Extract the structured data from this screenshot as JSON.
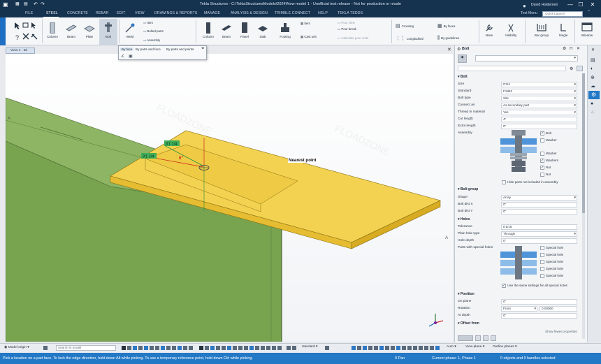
{
  "titlebar": {
    "title": "Tekla Structures - C:\\TeklaStructuresModels\\2024\\New model 1 - Unofficial test release - Not for production or resale",
    "user": "David Holdemen",
    "minimize": "—",
    "maximize": "☐",
    "close": "✕"
  },
  "menu": {
    "items": [
      "FILE",
      "STEEL",
      "CONCRETE",
      "REBAR",
      "EDIT",
      "VIEW",
      "DRAWINGS & REPORTS",
      "MANAGE",
      "ANALYSIS & DESIGN",
      "TRIMBLE CONNECT",
      "HELP",
      "TEKLA TEDDS"
    ],
    "active": "STEEL",
    "test_menu": "Test Menu",
    "quick_launch_placeholder": "Quick Launch"
  },
  "ribbon": {
    "left_tools": [
      "Column",
      "Beam",
      "Plate",
      "Bolt"
    ],
    "weld": "Weld",
    "weld_subitems": [
      "Item",
      "Bolted parts",
      "Assembly"
    ],
    "concrete_tools": [
      "Column",
      "Beam",
      "Panel",
      "Slab",
      "Footing"
    ],
    "cast_items": [
      "Item",
      "Cast unit"
    ],
    "pour_items": [
      "Pour view",
      "Pour break",
      "Calculate pour units"
    ],
    "rebar_items": [
      "Crossing",
      "Longitudinal",
      "By faces",
      "By guidelines"
    ],
    "right_tools": [
      "More",
      "Visibility",
      "Bar group",
      "Single",
      "Window"
    ]
  },
  "dropdown": {
    "options": [
      "By face",
      "By parts and face",
      "By parts and points"
    ]
  },
  "view": {
    "tab_label": "View 1 - 3d",
    "close": "✕",
    "labels": {
      "nearest_point": "Nearest point",
      "dim_red": "6\"",
      "dim_green_1": "3'1 1/4",
      "dim_green_2": "3'1 1/4",
      "edge_a_left": "A",
      "edge_a_right": "A"
    },
    "watermark": "FLOADZONE"
  },
  "panel": {
    "header": "Bolt",
    "sections": {
      "bolt": "Bolt",
      "bolt_group": "Bolt group",
      "holes": "Holes",
      "position": "Position",
      "offset": "Offset from"
    },
    "bolt": {
      "size_label": "Size",
      "size_value": "0'3/4",
      "standard_label": "Standard",
      "standard_value": "F1852",
      "bolt_type_label": "Bolt type",
      "bolt_type_value": "Site",
      "connect_label": "Connect as",
      "connect_value": "As secondary part",
      "thread_label": "Thread in material",
      "thread_value": "Yes",
      "cut_length_label": "Cut length",
      "cut_length_value": "4\"",
      "extra_length_label": "Extra length",
      "extra_length_value": "0\"",
      "assembly_label": "Assembly",
      "assembly_items": [
        {
          "label": "Bolt",
          "checked": "✓"
        },
        {
          "label": "Washer",
          "checked": ""
        },
        {
          "label": "Washer",
          "checked": ""
        },
        {
          "label": "Washers",
          "checked": "✓"
        },
        {
          "label": "Nut",
          "checked": "✓"
        },
        {
          "label": "Nut",
          "checked": ""
        }
      ],
      "hide_parts": "Hide parts not included in assembly"
    },
    "bolt_group": {
      "shape_label": "Shape",
      "shape_value": "Array",
      "dist_x_label": "Bolt dist X",
      "dist_x_value": "0\"",
      "dist_y_label": "Bolt dist Y",
      "dist_y_value": "0\""
    },
    "holes": {
      "tolerance_label": "Tolerance",
      "tolerance_value": "0'1/16",
      "plain_label": "Plain hole type",
      "plain_value": "Through",
      "depth_label": "Hole depth",
      "depth_value": "0\"",
      "special_label": "Parts with special holes",
      "special_items": [
        "Special hole",
        "Special hole",
        "Special hole",
        "Special hole",
        "Special hole"
      ],
      "same_settings": "Use the same settings for all special holes"
    },
    "position": {
      "on_plane_label": "On plane",
      "on_plane_value": "0\"",
      "rotation_label": "Rotation",
      "rotation_value": "Front",
      "rotation_angle": "0.00000",
      "at_depth_label": "At depth",
      "at_depth_value": "0\""
    },
    "show_fewer": "Show fewer properties"
  },
  "bottom_toolbar": {
    "model_origin": "Model origin",
    "search_placeholder": "Search in model",
    "standard": "standard",
    "auto": "Auto",
    "view_plane": "View plane",
    "outline_planes": "Outline planes"
  },
  "status": {
    "message": "Pick a location on a part face. To lock the edge direction, hold down Alt while picking. To use a temporary reference point, hold down Ctrl while picking.",
    "pan": "0 Pan",
    "phase": "Current phase: 1, Phase 1",
    "selected": "0 objects and 0 handles selected"
  },
  "colors": {
    "titlebar": "#15324f",
    "accent_blue": "#2379c6",
    "plate_yellow": "#f2d250",
    "beam_green": "#6f9a4e"
  }
}
